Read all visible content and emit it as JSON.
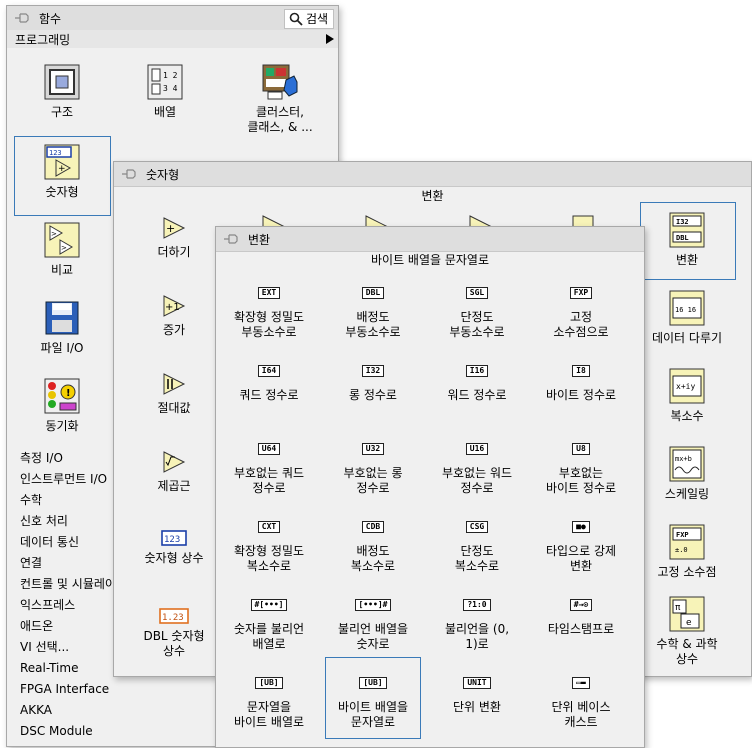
{
  "back": {
    "title": "함수",
    "search_label": "검색",
    "section": "프로그래밍",
    "icons": [
      "구조",
      "배열",
      "클러스터,\n클래스, & ...",
      "숫자형",
      "비교",
      "파일 I/O",
      "동기화"
    ],
    "categories": [
      "측정 I/O",
      "인스트루먼트 I/O",
      "수학",
      "신호 처리",
      "데이터 통신",
      "연결",
      "컨트롤 및 시뮬레이션",
      "익스프레스",
      "애드온",
      "VI 선택...",
      "Real-Time",
      "FPGA Interface",
      "AKKA",
      "DSC Module"
    ]
  },
  "middle": {
    "title": "숫자형",
    "subtitle": "변환",
    "left_items": [
      "더하기",
      "증가",
      "절대값",
      "제곱근",
      "숫자형 상수",
      "DBL 숫자형\n상수"
    ],
    "right_items": [
      "변환",
      "데이터 다루기",
      "복소수",
      "스케일링",
      "고정 소수점",
      "수학 & 과학\n상수"
    ]
  },
  "front": {
    "title": "변환",
    "subtitle": "바이트 배열을 문자열로",
    "items": [
      {
        "tag": "EXT",
        "label": "확장형 정밀도\n부동소수로"
      },
      {
        "tag": "DBL",
        "label": "배정도\n부동소수로"
      },
      {
        "tag": "SGL",
        "label": "단정도\n부동소수로"
      },
      {
        "tag": "FXP",
        "label": "고정\n소수점으로"
      },
      {
        "tag": "I64",
        "label": "쿼드 정수로"
      },
      {
        "tag": "I32",
        "label": "롱 정수로"
      },
      {
        "tag": "I16",
        "label": "워드 정수로"
      },
      {
        "tag": "I8",
        "label": "바이트 정수로"
      },
      {
        "tag": "U64",
        "label": "부호없는 쿼드\n정수로"
      },
      {
        "tag": "U32",
        "label": "부호없는 롱\n정수로"
      },
      {
        "tag": "U16",
        "label": "부호없는 워드\n정수로"
      },
      {
        "tag": "U8",
        "label": "부호없는\n바이트 정수로"
      },
      {
        "tag": "CXT",
        "label": "확장형 정밀도\n복소수로"
      },
      {
        "tag": "CDB",
        "label": "배정도\n복소수로"
      },
      {
        "tag": "CSG",
        "label": "단정도\n복소수로"
      },
      {
        "tag": "■●",
        "label": "타입으로 강제\n변환"
      },
      {
        "tag": "#[•••]",
        "label": "숫자를 불리언\n배열로"
      },
      {
        "tag": "[•••]#",
        "label": "불리언 배열을\n숫자로"
      },
      {
        "tag": "?1:0",
        "label": "불리언을 (0,\n1)로"
      },
      {
        "tag": "#→⊙",
        "label": "타임스탬프로"
      },
      {
        "tag": "[UB]",
        "label": "문자열을\n바이트 배열로"
      },
      {
        "tag": "[UB]",
        "label": "바이트 배열을\n문자열로"
      },
      {
        "tag": "UNIT",
        "label": "단위 변환"
      },
      {
        "tag": "▭▬",
        "label": "단위 베이스\n캐스트"
      }
    ]
  }
}
